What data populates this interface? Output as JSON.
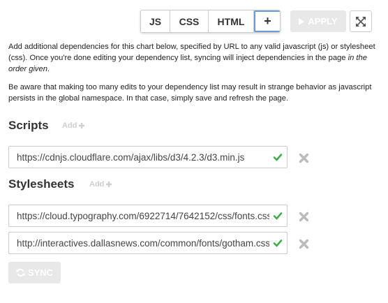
{
  "tabs": [
    {
      "label": "JS"
    },
    {
      "label": "CSS"
    },
    {
      "label": "HTML"
    },
    {
      "label": "+",
      "active": true
    }
  ],
  "apply": {
    "label": "APPLY",
    "enabled": false
  },
  "expand": {
    "icon": "expand-icon"
  },
  "description": {
    "paragraph1_main": "Add additional dependencies for this chart below, specified by URL to any valid javascript (js) or stylesheet (css). Once you're done editing your dependency list, syncing will inject dependencies in the page ",
    "paragraph1_emphasis": "in the order given",
    "paragraph1_end": ".",
    "paragraph2": "Be aware that making too many edits to your dependency list may result in strange behavior as javascript persists in the global namespace. In that case, simply save and refresh the page."
  },
  "scripts": {
    "title": "Scripts",
    "add_label": "Add",
    "items": [
      {
        "url": "https://cdnjs.cloudflare.com/ajax/libs/d3/4.2.3/d3.min.js",
        "valid": true
      }
    ]
  },
  "stylesheets": {
    "title": "Stylesheets",
    "add_label": "Add",
    "items": [
      {
        "url": "https://cloud.typography.com/6922714/7642152/css/fonts.css",
        "valid": true
      },
      {
        "url": "http://interactives.dallasnews.com/common/fonts/gotham.css",
        "valid": true
      }
    ]
  },
  "sync": {
    "label": "SYNC",
    "enabled": false
  },
  "colors": {
    "valid_check": "#3fae49",
    "remove_icon": "#bbbbbb",
    "active_tab_border": "#6c9bd8"
  }
}
